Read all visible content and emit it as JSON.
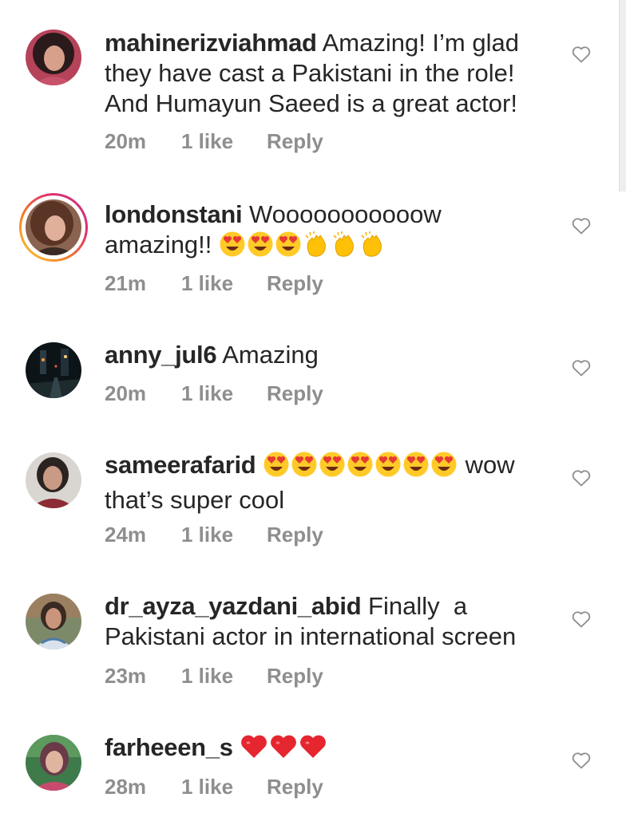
{
  "comments": [
    {
      "username": "mahinerizviahmad",
      "text": "Amazing! I’m glad they have cast a Pakistani in the role! And Humayun Saeed is a great actor!",
      "time": "20m",
      "likes": "1 like",
      "reply": "Reply",
      "emojis": []
    },
    {
      "username": "londonstani",
      "text": "Wooooooooooow amazing!!",
      "time": "21m",
      "likes": "1 like",
      "reply": "Reply",
      "emojis": [
        "heart-eyes-emoji",
        "heart-eyes-emoji",
        "heart-eyes-emoji",
        "clapping-hands-emoji",
        "clapping-hands-emoji",
        "clapping-hands-emoji"
      ]
    },
    {
      "username": "anny_jul6",
      "text": "Amazing",
      "time": "20m",
      "likes": "1 like",
      "reply": "Reply",
      "emojis": []
    },
    {
      "username": "sameerafarid",
      "text": "wow that’s super cool",
      "time": "24m",
      "likes": "1 like",
      "reply": "Reply",
      "emojis": [
        "heart-eyes-emoji",
        "heart-eyes-emoji",
        "heart-eyes-emoji",
        "heart-eyes-emoji",
        "heart-eyes-emoji",
        "heart-eyes-emoji",
        "heart-eyes-emoji"
      ]
    },
    {
      "username": "dr_ayza_yazdani_abid",
      "text": "Finally  a Pakistani actor in international screen",
      "time": "23m",
      "likes": "1 like",
      "reply": "Reply",
      "emojis": []
    },
    {
      "username": "farheeen_s",
      "text": "",
      "time": "28m",
      "likes": "1 like",
      "reply": "Reply",
      "emojis": [
        "red-heart-emoji",
        "red-heart-emoji",
        "red-heart-emoji"
      ]
    }
  ],
  "colors": {
    "text": "#262626",
    "meta": "#8e8e8e",
    "heart_outline": "#8e8e8e"
  },
  "icons": {
    "like": "heart-outline-icon"
  }
}
